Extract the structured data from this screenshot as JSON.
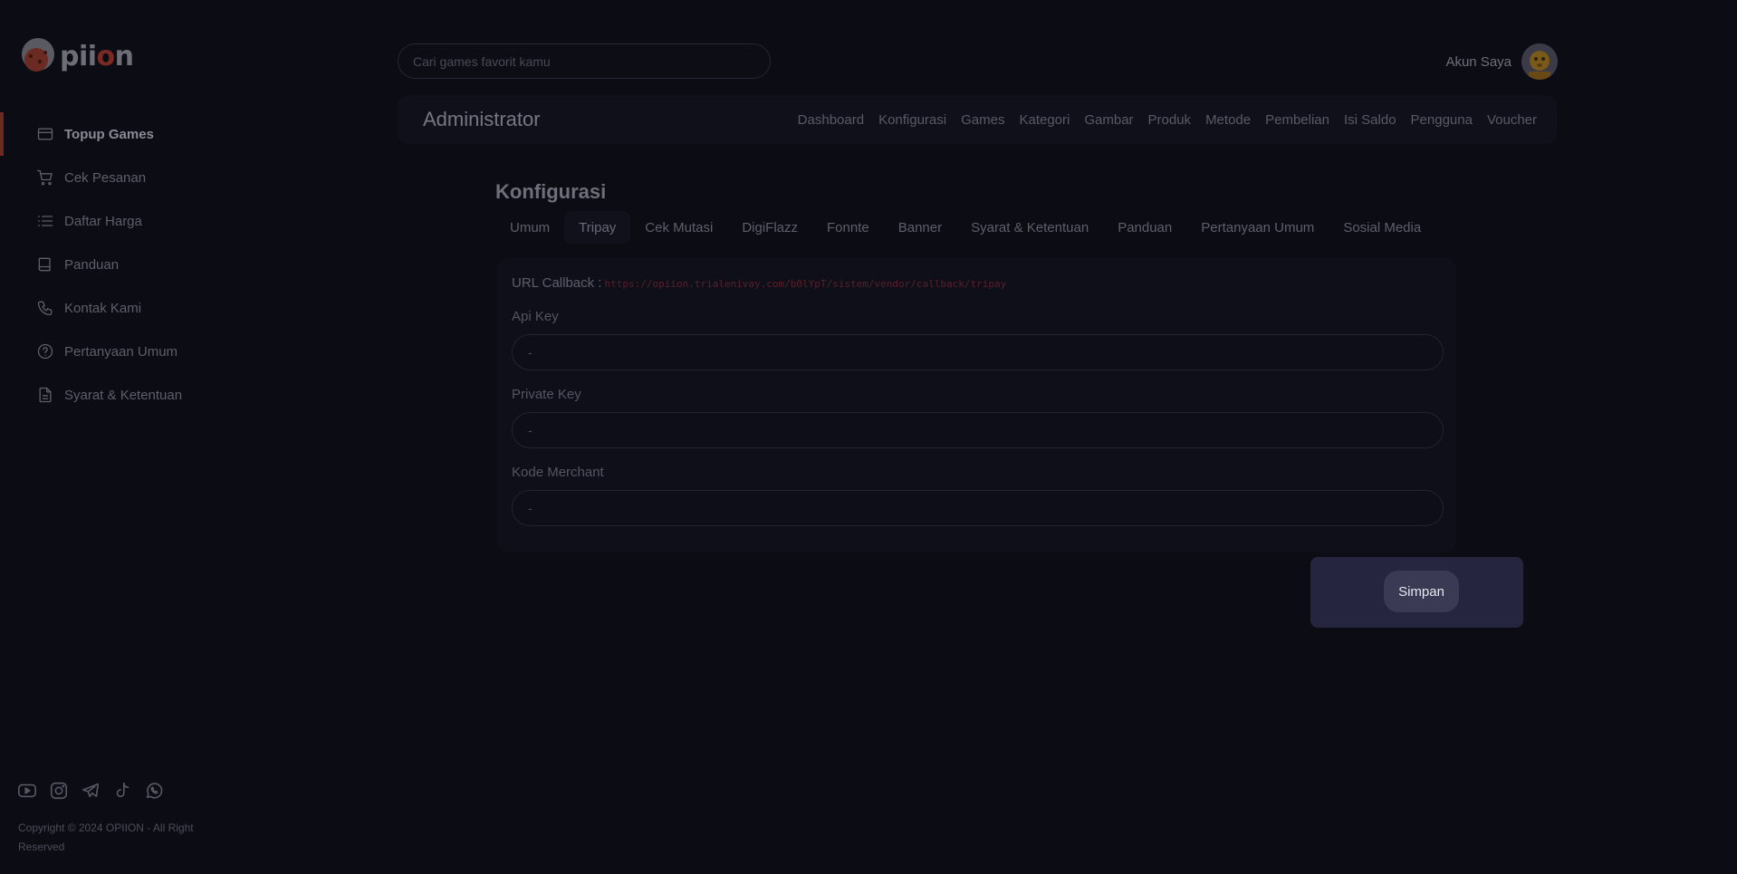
{
  "brand": {
    "logo_text_pre": "pii",
    "logo_text_o": "o",
    "logo_text_post": "n"
  },
  "sidebar": {
    "items": [
      {
        "label": "Topup Games",
        "icon": "card-icon",
        "active": true
      },
      {
        "label": "Cek Pesanan",
        "icon": "cart-icon"
      },
      {
        "label": "Daftar Harga",
        "icon": "list-icon"
      },
      {
        "label": "Panduan",
        "icon": "book-icon"
      },
      {
        "label": "Kontak Kami",
        "icon": "phone-icon"
      },
      {
        "label": "Pertanyaan Umum",
        "icon": "question-circle-icon"
      },
      {
        "label": "Syarat & Ketentuan",
        "icon": "document-icon"
      }
    ],
    "socials": [
      "youtube-icon",
      "instagram-icon",
      "telegram-icon",
      "tiktok-icon",
      "whatsapp-icon"
    ],
    "copyright": "Copyright © 2024 OPIION - All Right Reserved"
  },
  "header": {
    "search_placeholder": "Cari games favorit kamu",
    "account_label": "Akun Saya"
  },
  "admin": {
    "title": "Administrator",
    "nav": [
      "Dashboard",
      "Konfigurasi",
      "Games",
      "Kategori",
      "Gambar",
      "Produk",
      "Metode",
      "Pembelian",
      "Isi Saldo",
      "Pengguna",
      "Voucher"
    ]
  },
  "config": {
    "title": "Konfigurasi",
    "tabs": [
      "Umum",
      "Tripay",
      "Cek Mutasi",
      "DigiFlazz",
      "Fonnte",
      "Banner",
      "Syarat & Ketentuan",
      "Panduan",
      "Pertanyaan Umum",
      "Sosial Media"
    ],
    "active_tab": "Tripay",
    "callback_label": "URL Callback :",
    "callback_url": "https://opiion.trialenivay.com/b0lYpT/sistem/vendor/callback/tripay",
    "fields": [
      {
        "label": "Api Key",
        "value": "-"
      },
      {
        "label": "Private Key",
        "value": "-"
      },
      {
        "label": "Kode Merchant",
        "value": "-"
      }
    ],
    "save_label": "Simpan"
  },
  "colors": {
    "background": "#0c0c15",
    "accent": "#6e2a20",
    "panel": "#25253f"
  }
}
